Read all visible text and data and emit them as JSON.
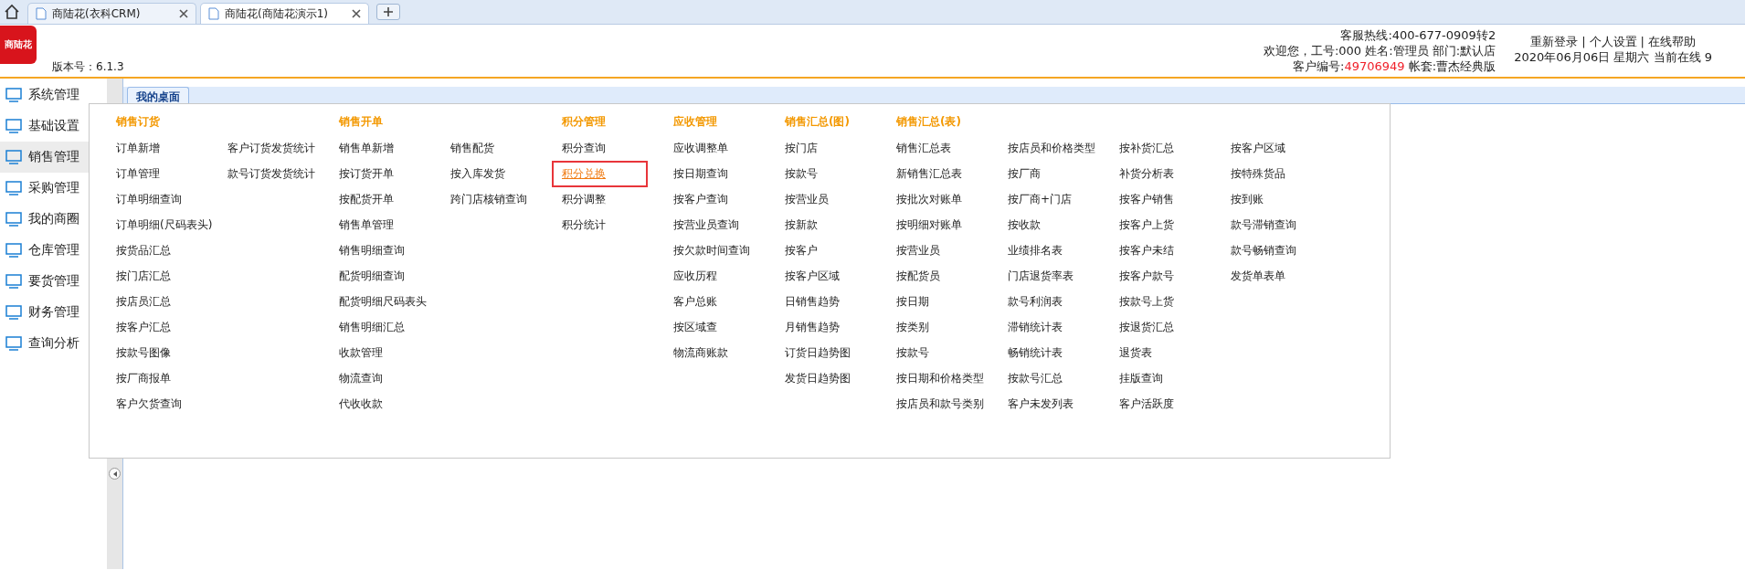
{
  "browser_tabs": [
    {
      "title": "商陆花(衣科CRM)",
      "selected": false
    },
    {
      "title": "商陆花(商陆花演示1)",
      "selected": true
    }
  ],
  "header": {
    "logo_text": "商陆花",
    "version": "版本号：6.1.3",
    "hotline": "客服热线:400-677-0909转2",
    "welcome": "欢迎您，工号:000 姓名:管理员 部门:默认店",
    "customer_label": "客户编号:",
    "customer_id": "49706949",
    "account": "帐套:曹杰经典版",
    "links": [
      "重新登录",
      "个人设置",
      "在线帮助"
    ],
    "separator": "|",
    "date_line": "2020年06月06日 星期六 当前在线 9"
  },
  "sidebar": {
    "items": [
      {
        "label": "系统管理",
        "selected": false
      },
      {
        "label": "基础设置",
        "selected": false
      },
      {
        "label": "销售管理",
        "selected": true
      },
      {
        "label": "采购管理",
        "selected": false
      },
      {
        "label": "我的商圈",
        "selected": false
      },
      {
        "label": "仓库管理",
        "selected": false
      },
      {
        "label": "要货管理",
        "selected": false
      },
      {
        "label": "财务管理",
        "selected": false
      },
      {
        "label": "查询分析",
        "selected": false
      }
    ]
  },
  "content_tabs": [
    "我的桌面"
  ],
  "menu": {
    "groups": [
      {
        "title": "销售订货",
        "columns": [
          [
            {
              "label": "订单新增",
              "selected": false
            },
            {
              "label": "订单管理",
              "selected": false
            },
            {
              "label": "订单明细查询",
              "selected": false
            },
            {
              "label": "订单明细(尺码表头)",
              "selected": false
            },
            {
              "label": "按货品汇总",
              "selected": false
            },
            {
              "label": "按门店汇总",
              "selected": false
            },
            {
              "label": "按店员汇总",
              "selected": false
            },
            {
              "label": "按客户汇总",
              "selected": false
            },
            {
              "label": "按款号图像",
              "selected": false
            },
            {
              "label": "按厂商报单",
              "selected": false
            },
            {
              "label": "客户欠货查询",
              "selected": false
            }
          ],
          [
            {
              "label": "客户订货发货统计",
              "selected": false
            },
            {
              "label": "款号订货发货统计",
              "selected": false
            }
          ]
        ]
      },
      {
        "title": "销售开单",
        "columns": [
          [
            {
              "label": "销售单新增",
              "selected": false
            },
            {
              "label": "按订货开单",
              "selected": false
            },
            {
              "label": "按配货开单",
              "selected": false
            },
            {
              "label": "销售单管理",
              "selected": false
            },
            {
              "label": "销售明细查询",
              "selected": false
            },
            {
              "label": "配货明细查询",
              "selected": false
            },
            {
              "label": "配货明细尺码表头",
              "selected": false
            },
            {
              "label": "销售明细汇总",
              "selected": false
            },
            {
              "label": "收款管理",
              "selected": false
            },
            {
              "label": "物流查询",
              "selected": false
            },
            {
              "label": "代收收款",
              "selected": false
            }
          ],
          [
            {
              "label": "销售配货",
              "selected": false
            },
            {
              "label": "按入库发货",
              "selected": false
            },
            {
              "label": "跨门店核销查询",
              "selected": false
            }
          ]
        ]
      },
      {
        "title": "积分管理",
        "columns": [
          [
            {
              "label": "积分查询",
              "selected": false
            },
            {
              "label": "积分兑换",
              "selected": true
            },
            {
              "label": "积分调整",
              "selected": false
            },
            {
              "label": "积分统计",
              "selected": false
            }
          ]
        ]
      },
      {
        "title": "应收管理",
        "columns": [
          [
            {
              "label": "应收调整单",
              "selected": false
            },
            {
              "label": "按日期查询",
              "selected": false
            },
            {
              "label": "按客户查询",
              "selected": false
            },
            {
              "label": "按营业员查询",
              "selected": false
            },
            {
              "label": "按欠款时间查询",
              "selected": false
            },
            {
              "label": "应收历程",
              "selected": false
            },
            {
              "label": "客户总账",
              "selected": false
            },
            {
              "label": "按区域查",
              "selected": false
            },
            {
              "label": "物流商账款",
              "selected": false
            }
          ]
        ]
      },
      {
        "title": "销售汇总(图)",
        "columns": [
          [
            {
              "label": "按门店",
              "selected": false
            },
            {
              "label": "按款号",
              "selected": false
            },
            {
              "label": "按营业员",
              "selected": false
            },
            {
              "label": "按新款",
              "selected": false
            },
            {
              "label": "按客户",
              "selected": false
            },
            {
              "label": "按客户区域",
              "selected": false
            },
            {
              "label": "日销售趋势",
              "selected": false
            },
            {
              "label": "月销售趋势",
              "selected": false
            },
            {
              "label": "订货日趋势图",
              "selected": false
            },
            {
              "label": "发货日趋势图",
              "selected": false
            }
          ]
        ]
      },
      {
        "title": "销售汇总(表)",
        "columns": [
          [
            {
              "label": "销售汇总表",
              "selected": false
            },
            {
              "label": "新销售汇总表",
              "selected": false
            },
            {
              "label": "按批次对账单",
              "selected": false
            },
            {
              "label": "按明细对账单",
              "selected": false
            },
            {
              "label": "按营业员",
              "selected": false
            },
            {
              "label": "按配货员",
              "selected": false
            },
            {
              "label": "按日期",
              "selected": false
            },
            {
              "label": "按类别",
              "selected": false
            },
            {
              "label": "按款号",
              "selected": false
            },
            {
              "label": "按日期和价格类型",
              "selected": false
            },
            {
              "label": "按店员和款号类别",
              "selected": false
            }
          ],
          [
            {
              "label": "按店员和价格类型",
              "selected": false
            },
            {
              "label": "按厂商",
              "selected": false
            },
            {
              "label": "按厂商+门店",
              "selected": false
            },
            {
              "label": "按收款",
              "selected": false
            },
            {
              "label": "业绩排名表",
              "selected": false
            },
            {
              "label": "门店退货率表",
              "selected": false
            },
            {
              "label": "款号利润表",
              "selected": false
            },
            {
              "label": "滞销统计表",
              "selected": false
            },
            {
              "label": "畅销统计表",
              "selected": false
            },
            {
              "label": "按款号汇总",
              "selected": false
            },
            {
              "label": "客户未发列表",
              "selected": false
            }
          ],
          [
            {
              "label": "按补货汇总",
              "selected": false
            },
            {
              "label": "补货分析表",
              "selected": false
            },
            {
              "label": "按客户销售",
              "selected": false
            },
            {
              "label": "按客户上货",
              "selected": false
            },
            {
              "label": "按客户未结",
              "selected": false
            },
            {
              "label": "按客户款号",
              "selected": false
            },
            {
              "label": "按款号上货",
              "selected": false
            },
            {
              "label": "按退货汇总",
              "selected": false
            },
            {
              "label": "退货表",
              "selected": false
            },
            {
              "label": "挂版查询",
              "selected": false
            },
            {
              "label": "客户活跃度",
              "selected": false
            }
          ],
          [
            {
              "label": "按客户区域",
              "selected": false
            },
            {
              "label": "按特殊货品",
              "selected": false
            },
            {
              "label": "按到账",
              "selected": false
            },
            {
              "label": "款号滞销查询",
              "selected": false
            },
            {
              "label": "款号畅销查询",
              "selected": false
            },
            {
              "label": "发货单表单",
              "selected": false
            }
          ]
        ]
      }
    ]
  }
}
